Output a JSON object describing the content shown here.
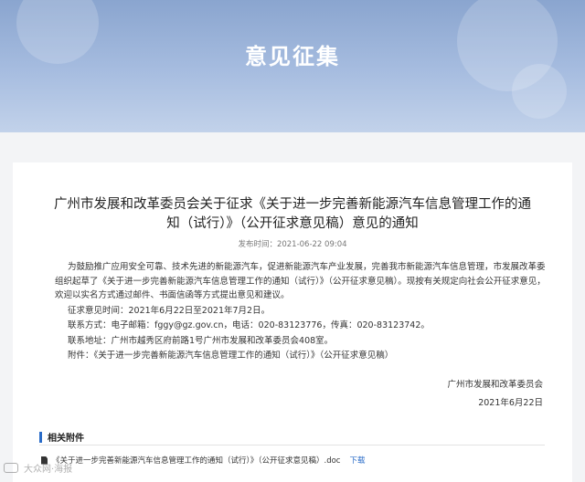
{
  "banner": {
    "title": "意见征集"
  },
  "article": {
    "title": "广州市发展和改革委员会关于征求《关于进一步完善新能源汽车信息管理工作的通知（试行）》（公开征求意见稿）意见的通知",
    "pubtime": "发布时间：2021-06-22 09:04",
    "para1": "为鼓励推广应用安全可靠、技术先进的新能源汽车，促进新能源汽车产业发展，完善我市新能源汽车信息管理，市发展改革委组织起草了《关于进一步完善新能源汽车信息管理工作的通知（试行）》（公开征求意见稿）。现按有关规定向社会公开征求意见，欢迎以实名方式通过邮件、书面信函等方式提出意见和建议。",
    "period": "征求意见时间：2021年6月22日至2021年7月2日。",
    "contact": "联系方式：电子邮箱：fggy@gz.gov.cn，电话：020-83123776，传真：020-83123742。",
    "address": "联系地址：广州市越秀区府前路1号广州市发展和改革委员会408室。",
    "attachment_note": "附件：《关于进一步完善新能源汽车信息管理工作的通知（试行）》（公开征求意见稿）",
    "sign_org": "广州市发展和改革委员会",
    "sign_date": "2021年6月22日"
  },
  "attachments": {
    "heading": "相关附件",
    "file": "《关于进一步完善新能源汽车信息管理工作的通知（试行）》（公开征求意见稿）.doc",
    "download_label": "下载"
  },
  "watermark": {
    "text": "大众网·海报"
  }
}
